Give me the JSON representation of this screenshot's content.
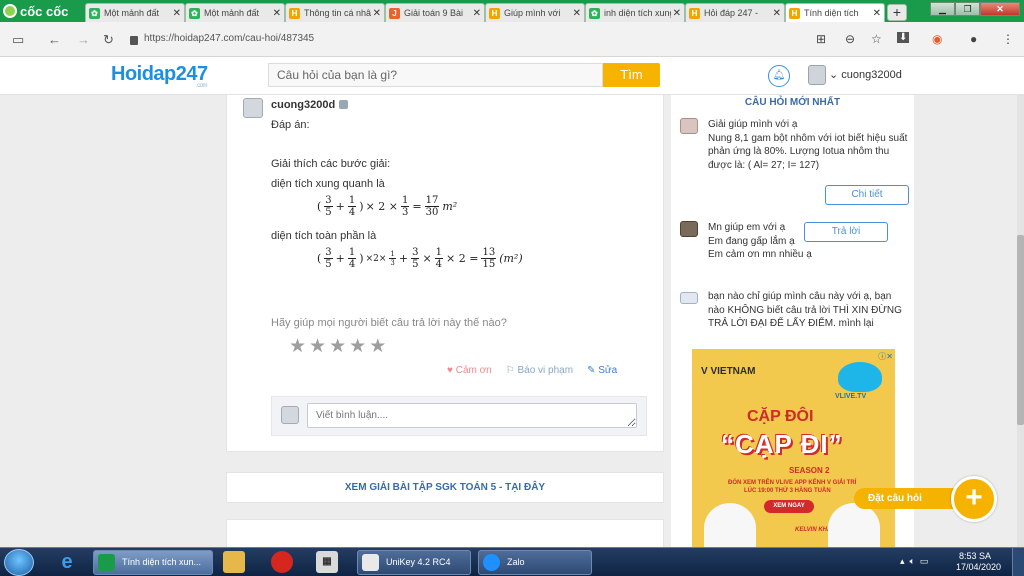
{
  "browser": {
    "logo_text": "cốc cốc",
    "tabs": [
      {
        "label": "Một mảnh đất",
        "fav": "green",
        "active": false
      },
      {
        "label": "Một mảnh đất",
        "fav": "green",
        "active": false
      },
      {
        "label": "Thông tin cá nhân",
        "fav": "hd",
        "active": false
      },
      {
        "label": "Giải toán 9 Bài",
        "fav": "j",
        "active": false
      },
      {
        "label": "Giúp mình với",
        "fav": "hd",
        "active": false
      },
      {
        "label": "inh diện tích xung",
        "fav": "green",
        "active": false
      },
      {
        "label": "Hỏi đáp 247 -",
        "fav": "hd",
        "active": false
      },
      {
        "label": "Tính diện tích",
        "fav": "hd",
        "active": true
      }
    ],
    "new_tab": "+",
    "url": "https://hoidap247.com/cau-hoi/487345"
  },
  "site": {
    "brand": "Hoidap247",
    "brand_sub": ".com",
    "search_placeholder": "Câu hỏi của bạn là gì?",
    "search_button": "Tìm",
    "username": "cuong3200d"
  },
  "answer": {
    "author": "cuong3200d",
    "title": "Đáp án:",
    "explain_label": "Giải thích các bước giải:",
    "line1": "diện tích xung quanh là",
    "line2": "diện tích toàn phần là",
    "math1": {
      "f1": [
        "3",
        "5"
      ],
      "f2": [
        "1",
        "4"
      ],
      "times2": "× 2 ×",
      "f3": [
        "1",
        "3"
      ],
      "eq": "=",
      "f4": [
        "17",
        "30"
      ],
      "unit": "m²"
    },
    "math2": {
      "f1": [
        "3",
        "5"
      ],
      "f2": [
        "1",
        "4"
      ],
      "times2": "×2×",
      "f3": [
        "1",
        "3"
      ],
      "f4": [
        "3",
        "5"
      ],
      "f5": [
        "1",
        "4"
      ],
      "times4": "× 2 =",
      "f6": [
        "13",
        "15"
      ],
      "unit": "(m²)"
    },
    "rate_prompt": "Hãy giúp mọi người biết câu trả lời này thế nào?",
    "stars": 5,
    "stars_filled": 0,
    "actions": {
      "thanks": "Cảm ơn",
      "report": "Báo vi phạm",
      "edit": "Sửa"
    },
    "comment_placeholder": "Viết bình luận...."
  },
  "solve_link": "XEM GIẢI BÀI TẬP SGK TOÁN 5 - TẠI ĐÂY",
  "sidebar": {
    "title": "CÂU HỎI MỚI NHẤT",
    "questions": [
      {
        "text": "Giải giúp mình với ạ\nNung 8,1 gam bột nhôm với iot biết hiệu suất phản ứng là 80%. Lượng Iotua nhôm thu được là: ( Al= 27;  I= 127)",
        "button": "Chi tiết"
      },
      {
        "text": "Mn giúp em với ạ\nEm đang gấp lắm ạ\nEm cảm ơn mn nhiều ạ",
        "button": "Trả lời"
      },
      {
        "text": "bạn nào chỉ giúp mình câu này với ạ, bạn nào KHÔNG biết câu trả lời THÌ XIN ĐỪNG TRẢ LỜI ĐẠI ĐỂ LẤY ĐIỂM. mình lại",
        "button": ""
      }
    ]
  },
  "ad": {
    "brand": "V VIETNAM",
    "vlive": "VLIVE.TV",
    "close": "ⓘ✕",
    "headline1": "CẶP ĐÔI",
    "headline2": "“CẠP ĐI”",
    "season": "SEASON 2",
    "line1": "ĐÓN XEM TRÊN VLIVE APP KÊNH V GIẢI TRÍ",
    "line2": "LÚC 19:00 THỨ 3 HÀNG TUẦN",
    "button": "XEM NGAY",
    "credit": "KELVIN KHÁNH"
  },
  "ask": {
    "label": "Đặt câu hỏi",
    "plus": "+"
  },
  "taskbar": {
    "apps": [
      {
        "label": "Tính diện tích xun...",
        "active": true
      },
      {
        "label": "UniKey 4.2 RC4",
        "active": false
      },
      {
        "label": "Zalo",
        "active": false
      }
    ],
    "time": "8:53 SA",
    "date": "17/04/2020"
  }
}
